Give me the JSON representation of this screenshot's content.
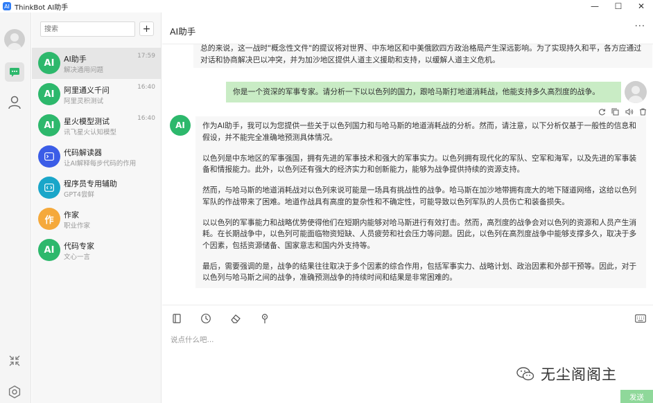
{
  "app": {
    "title": "ThinkBot AI助手",
    "logo_text": "AI"
  },
  "window_controls": {
    "minimize": "—",
    "maximize": "☐",
    "close": "✕"
  },
  "sidebar": {
    "search_placeholder": "搜索",
    "add_label": "+",
    "items": [
      {
        "icon_text": "AI",
        "name": "AI助手",
        "subtitle": "解决通用问题",
        "time": "17:59",
        "color": "#2db86c"
      },
      {
        "icon_text": "AI",
        "name": "阿里通义千问",
        "subtitle": "阿里灵积测试",
        "time": "16:40",
        "color": "#2db86c"
      },
      {
        "icon_text": "AI",
        "name": "星火模型测试",
        "subtitle": "讯飞星火认知模型",
        "time": "16:40",
        "color": "#2db86c"
      },
      {
        "icon_text": "",
        "name": "代码解读器",
        "subtitle": "让AI解释每步代码的作用",
        "time": "",
        "color": "#3b5de7"
      },
      {
        "icon_text": "",
        "name": "程序员专用辅助",
        "subtitle": "GPT4尝鲜",
        "time": "",
        "color": "#1aa6c9"
      },
      {
        "icon_text": "作",
        "name": "作家",
        "subtitle": "职业作家",
        "time": "",
        "color": "#f5a93b"
      },
      {
        "icon_text": "AI",
        "name": "代码专家",
        "subtitle": "文心一言",
        "time": "",
        "color": "#2db86c"
      }
    ]
  },
  "chat": {
    "title": "AI助手",
    "more": "···",
    "prev_answer": "总的来说，这一战时\"概念性文件\"的提议将对世界、中东地区和中美俄欧四方政治格局产生深远影响。为了实现持久和平，各方应通过对话和协商解决巴以冲突，并为加沙地区提供人道主义援助和支持，以缓解人道主义危机。",
    "user_message": "你是一个资深的军事专家。请分析一下以以色列的国力，跟哈马斯打地道消耗战，他能支持多久高烈度的战争。",
    "ai_avatar": "AI",
    "answer_paragraphs": [
      "作为AI助手，我可以为您提供一些关于以色列国力和与哈马斯的地道消耗战的分析。然而，请注意，以下分析仅基于一般性的信息和假设，并不能完全准确地预测具体情况。",
      "以色列是中东地区的军事强国，拥有先进的军事技术和强大的军事实力。以色列拥有现代化的军队、空军和海军，以及先进的军事装备和情报能力。此外，以色列还有强大的经济实力和创新能力，能够为战争提供持续的资源支持。",
      "然而，与哈马斯的地道消耗战对以色列来说可能是一场具有挑战性的战争。哈马斯在加沙地带拥有庞大的地下隧道网络，这给以色列军队的作战带来了困难。地道作战具有高度的复杂性和不确定性，可能导致以色列军队的人员伤亡和装备损失。",
      "以以色列的军事能力和战略优势使得他们在短期内能够对哈马斯进行有效打击。然而，高烈度的战争会对以色列的资源和人员产生消耗。在长期战争中，以色列可能面临物资短缺、人员疲劳和社会压力等问题。因此，以色列在高烈度战争中能够支撑多久，取决于多个因素，包括资源储备、国家意志和国内外支持等。",
      "最后，需要强调的是，战争的结果往往取决于多个因素的综合作用，包括军事实力、战略计划、政治因素和外部干预等。因此，对于以色列与哈马斯之间的战争，准确预测战争的持续时间和结果是非常困难的。"
    ]
  },
  "composer": {
    "placeholder": "说点什么吧...",
    "send_label": "发送"
  },
  "watermark": {
    "text": "无尘阁阁主"
  },
  "colors": {
    "accent": "#2db86c",
    "user_bubble": "#c9ecc5",
    "send_button": "#8fd89a"
  }
}
